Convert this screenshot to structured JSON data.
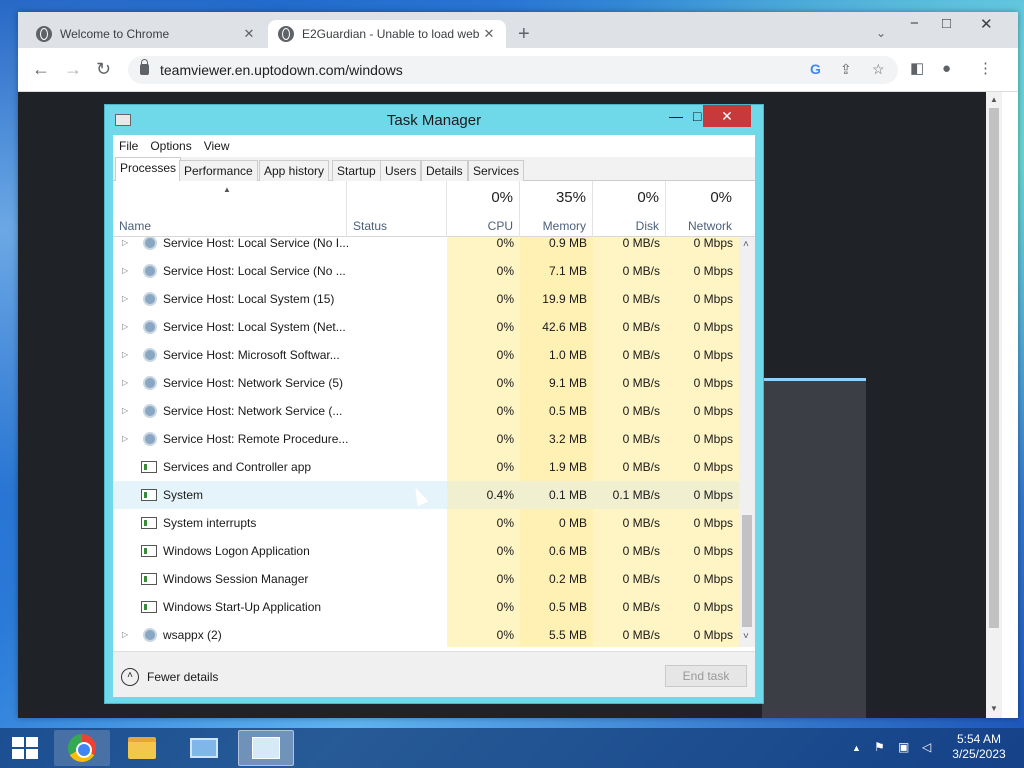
{
  "browser": {
    "tabs": [
      {
        "title": "Welcome to Chrome",
        "active": false
      },
      {
        "title": "E2Guardian - Unable to load web",
        "active": true
      }
    ],
    "new_tab": "+",
    "url": "teamviewer.en.uptodown.com/windows",
    "window_controls": {
      "minimize": "−",
      "maximize": "□",
      "close": "✕"
    },
    "icons": {
      "back": "←",
      "forward": "→",
      "reload": "↻",
      "google": "G",
      "share": "⇪",
      "bookmark": "☆",
      "sidepanel": "◧",
      "profile": "●",
      "menu": "⋮",
      "tab_search": "⌄",
      "tab_close": "✕"
    }
  },
  "task_manager": {
    "title": "Task Manager",
    "controls": {
      "minimize": "—",
      "maximize": "□",
      "close": "✕"
    },
    "menu": [
      "File",
      "Options",
      "View"
    ],
    "tabs": [
      "Processes",
      "Performance",
      "App history",
      "Startup",
      "Users",
      "Details",
      "Services"
    ],
    "selected_tab": "Processes",
    "columns": {
      "name": "Name",
      "status": "Status",
      "cpu": {
        "label": "CPU",
        "pct": "0%"
      },
      "memory": {
        "label": "Memory",
        "pct": "35%"
      },
      "disk": {
        "label": "Disk",
        "pct": "0%"
      },
      "network": {
        "label": "Network",
        "pct": "0%"
      }
    },
    "rows": [
      {
        "name": "Service Host: Local Service (No I...",
        "cpu": "0%",
        "mem": "0.9 MB",
        "disk": "0 MB/s",
        "net": "0 Mbps",
        "expandable": true,
        "icon": "gear-icon"
      },
      {
        "name": "Service Host: Local Service (No ...",
        "cpu": "0%",
        "mem": "7.1 MB",
        "disk": "0 MB/s",
        "net": "0 Mbps",
        "expandable": true,
        "icon": "gear-icon"
      },
      {
        "name": "Service Host: Local System (15)",
        "cpu": "0%",
        "mem": "19.9 MB",
        "disk": "0 MB/s",
        "net": "0 Mbps",
        "expandable": true,
        "icon": "gear-icon"
      },
      {
        "name": "Service Host: Local System (Net...",
        "cpu": "0%",
        "mem": "42.6 MB",
        "disk": "0 MB/s",
        "net": "0 Mbps",
        "expandable": true,
        "icon": "gear-icon"
      },
      {
        "name": "Service Host: Microsoft Softwar...",
        "cpu": "0%",
        "mem": "1.0 MB",
        "disk": "0 MB/s",
        "net": "0 Mbps",
        "expandable": true,
        "icon": "gear-icon"
      },
      {
        "name": "Service Host: Network Service (5)",
        "cpu": "0%",
        "mem": "9.1 MB",
        "disk": "0 MB/s",
        "net": "0 Mbps",
        "expandable": true,
        "icon": "gear-icon"
      },
      {
        "name": "Service Host: Network Service (...",
        "cpu": "0%",
        "mem": "0.5 MB",
        "disk": "0 MB/s",
        "net": "0 Mbps",
        "expandable": true,
        "icon": "gear-icon"
      },
      {
        "name": "Service Host: Remote Procedure...",
        "cpu": "0%",
        "mem": "3.2 MB",
        "disk": "0 MB/s",
        "net": "0 Mbps",
        "expandable": true,
        "icon": "gear-icon"
      },
      {
        "name": "Services and Controller app",
        "cpu": "0%",
        "mem": "1.9 MB",
        "disk": "0 MB/s",
        "net": "0 Mbps",
        "expandable": false,
        "icon": "app-window-icon"
      },
      {
        "name": "System",
        "cpu": "0.4%",
        "mem": "0.1 MB",
        "disk": "0.1 MB/s",
        "net": "0 Mbps",
        "expandable": false,
        "icon": "app-window-icon",
        "selected": true
      },
      {
        "name": "System interrupts",
        "cpu": "0%",
        "mem": "0 MB",
        "disk": "0 MB/s",
        "net": "0 Mbps",
        "expandable": false,
        "icon": "app-window-icon"
      },
      {
        "name": "Windows Logon Application",
        "cpu": "0%",
        "mem": "0.6 MB",
        "disk": "0 MB/s",
        "net": "0 Mbps",
        "expandable": false,
        "icon": "app-window-icon"
      },
      {
        "name": "Windows Session Manager",
        "cpu": "0%",
        "mem": "0.2 MB",
        "disk": "0 MB/s",
        "net": "0 Mbps",
        "expandable": false,
        "icon": "app-window-icon"
      },
      {
        "name": "Windows Start-Up Application",
        "cpu": "0%",
        "mem": "0.5 MB",
        "disk": "0 MB/s",
        "net": "0 Mbps",
        "expandable": false,
        "icon": "app-window-icon"
      },
      {
        "name": "wsappx (2)",
        "cpu": "0%",
        "mem": "5.5 MB",
        "disk": "0 MB/s",
        "net": "0 Mbps",
        "expandable": true,
        "icon": "gear-icon"
      }
    ],
    "footer": {
      "fewer_details": "Fewer details",
      "end_task": "End task"
    }
  },
  "taskbar": {
    "items": [
      "start",
      "chrome",
      "file-explorer",
      "remote-desktop",
      "task-manager"
    ],
    "time": "5:54 AM",
    "date": "3/25/2023"
  }
}
